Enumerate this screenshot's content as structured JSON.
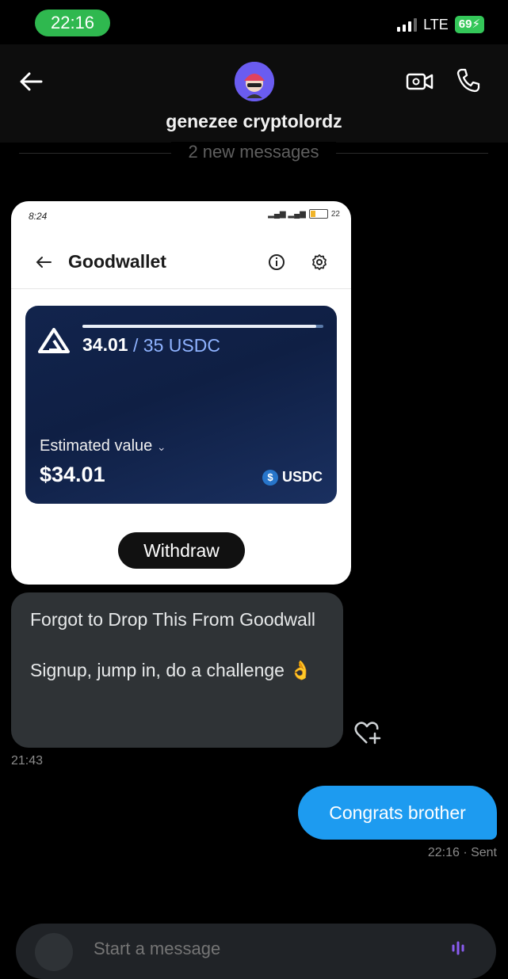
{
  "status_bar": {
    "time": "22:16",
    "network": "LTE",
    "battery": "69"
  },
  "header": {
    "contact_name": "genezee cryptolordz"
  },
  "divider": {
    "text": "2 new messages"
  },
  "shared_screenshot": {
    "time": "8:24",
    "status_text": "22",
    "app_title": "Goodwallet",
    "balance_current": "34.01",
    "balance_total": "/ 35 USDC",
    "progress_fraction": 0.97,
    "estimated_label": "Estimated value",
    "estimated_value": "$34.01",
    "currency": "USDC",
    "withdraw_label": "Withdraw"
  },
  "messages": {
    "received_text": "Forgot to Drop This From Goodwall\n\nSignup, jump in, do a challenge 👌",
    "received_time": "21:43",
    "sent_text": "Congrats brother",
    "sent_status": "22:16 · Sent"
  },
  "composer": {
    "placeholder": "Start a message"
  },
  "colors": {
    "accent": "#1d9bf0",
    "bubble_in": "#2f3336",
    "status_green": "#2fb84f"
  }
}
